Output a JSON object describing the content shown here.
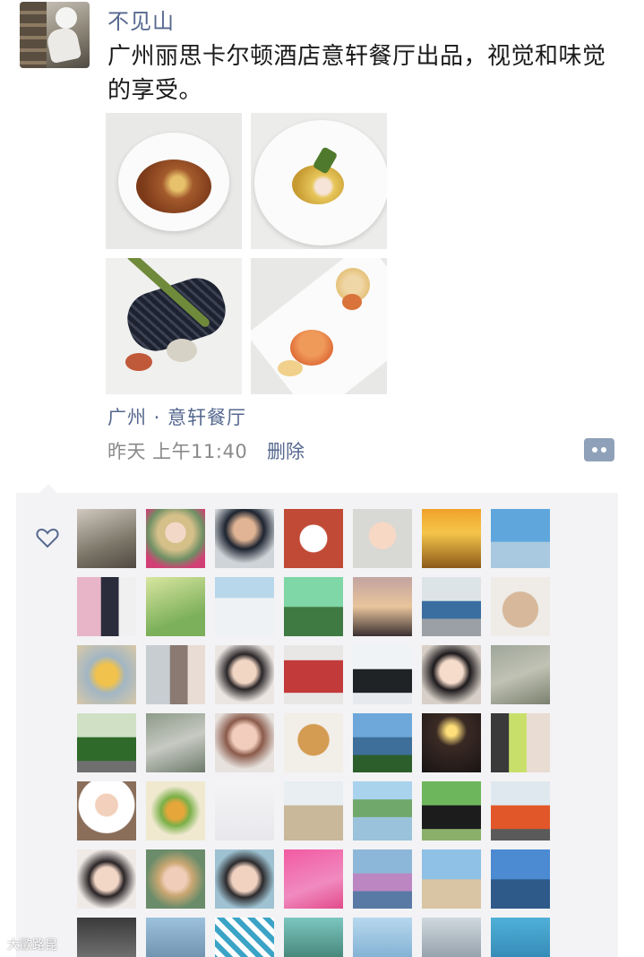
{
  "post": {
    "author": "不见山",
    "text": "广州丽思卡尔顿酒店意轩餐厅出品，视觉和味觉的享受。",
    "location": "广州 · 意轩餐厅",
    "time": "昨天 上午11:40",
    "delete_label": "删除"
  },
  "likes": {
    "icon": "heart-outline-icon",
    "count_visible": 49
  },
  "watermark": "大歐路昆",
  "colors": {
    "link": "#56688f",
    "time": "#8a8a8a",
    "likes_bg": "#f3f3f5",
    "comment_button": "#8fa1b8"
  }
}
